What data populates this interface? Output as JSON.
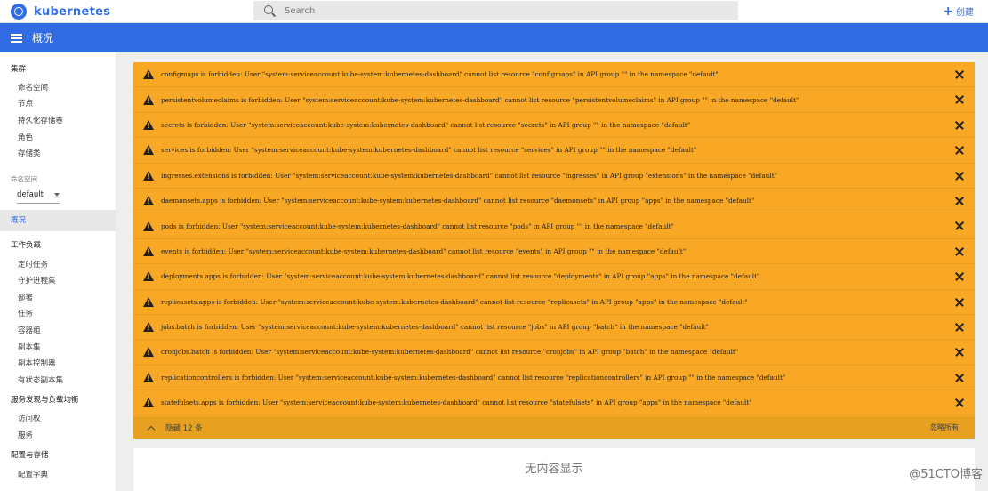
{
  "app": {
    "logo_text": "kubernetes"
  },
  "search": {
    "placeholder": "Search"
  },
  "header": {
    "create_label": "创建",
    "page_title": "概况"
  },
  "sidebar": {
    "cluster_heading": "集群",
    "cluster_items": [
      "命名空间",
      "节点",
      "持久化存储卷",
      "角色",
      "存储类"
    ],
    "namespace_label": "命名空间",
    "namespace_value": "default",
    "overview": "概况",
    "workloads_heading": "工作负载",
    "workload_items": [
      "定时任务",
      "守护进程集",
      "部署",
      "任务",
      "容器组",
      "副本集",
      "副本控制器",
      "有状态副本集"
    ],
    "discovery_heading": "服务发现与负载均衡",
    "discovery_items": [
      "访问权",
      "服务"
    ],
    "config_heading": "配置与存储",
    "config_items": [
      "配置字典"
    ]
  },
  "alerts": {
    "messages": [
      "configmaps is forbidden: User \"system:serviceaccount:kube-system:kubernetes-dashboard\" cannot list resource \"configmaps\" in API group \"\" in the namespace \"default\"",
      "persistentvolumeclaims is forbidden: User \"system:serviceaccount:kube-system:kubernetes-dashboard\" cannot list resource \"persistentvolumeclaims\" in API group \"\" in the namespace \"default\"",
      "secrets is forbidden: User \"system:serviceaccount:kube-system:kubernetes-dashboard\" cannot list resource \"secrets\" in API group \"\" in the namespace \"default\"",
      "services is forbidden: User \"system:serviceaccount:kube-system:kubernetes-dashboard\" cannot list resource \"services\" in API group \"\" in the namespace \"default\"",
      "ingresses.extensions is forbidden: User \"system:serviceaccount:kube-system:kubernetes-dashboard\" cannot list resource \"ingresses\" in API group \"extensions\" in the namespace \"default\"",
      "daemonsets.apps is forbidden: User \"system:serviceaccount:kube-system:kubernetes-dashboard\" cannot list resource \"daemonsets\" in API group \"apps\" in the namespace \"default\"",
      "pods is forbidden: User \"system:serviceaccount:kube-system:kubernetes-dashboard\" cannot list resource \"pods\" in API group \"\" in the namespace \"default\"",
      "events is forbidden: User \"system:serviceaccount:kube-system:kubernetes-dashboard\" cannot list resource \"events\" in API group \"\" in the namespace \"default\"",
      "deployments.apps is forbidden: User \"system:serviceaccount:kube-system:kubernetes-dashboard\" cannot list resource \"deployments\" in API group \"apps\" in the namespace \"default\"",
      "replicasets.apps is forbidden: User \"system:serviceaccount:kube-system:kubernetes-dashboard\" cannot list resource \"replicasets\" in API group \"apps\" in the namespace \"default\"",
      "jobs.batch is forbidden: User \"system:serviceaccount:kube-system:kubernetes-dashboard\" cannot list resource \"jobs\" in API group \"batch\" in the namespace \"default\"",
      "cronjobs.batch is forbidden: User \"system:serviceaccount:kube-system:kubernetes-dashboard\" cannot list resource \"cronjobs\" in API group \"batch\" in the namespace \"default\"",
      "replicationcontrollers is forbidden: User \"system:serviceaccount:kube-system:kubernetes-dashboard\" cannot list resource \"replicationcontrollers\" in API group \"\" in the namespace \"default\"",
      "statefulsets.apps is forbidden: User \"system:serviceaccount:kube-system:kubernetes-dashboard\" cannot list resource \"statefulsets\" in API group \"apps\" in the namespace \"default\""
    ],
    "hide_label": "隐藏 12 条",
    "ignore_all_label": "忽略所有"
  },
  "empty": {
    "title": "无内容显示"
  },
  "watermark": "@51CTO博客",
  "colors": {
    "accent": "#326ce5",
    "warning": "#f9a825"
  }
}
